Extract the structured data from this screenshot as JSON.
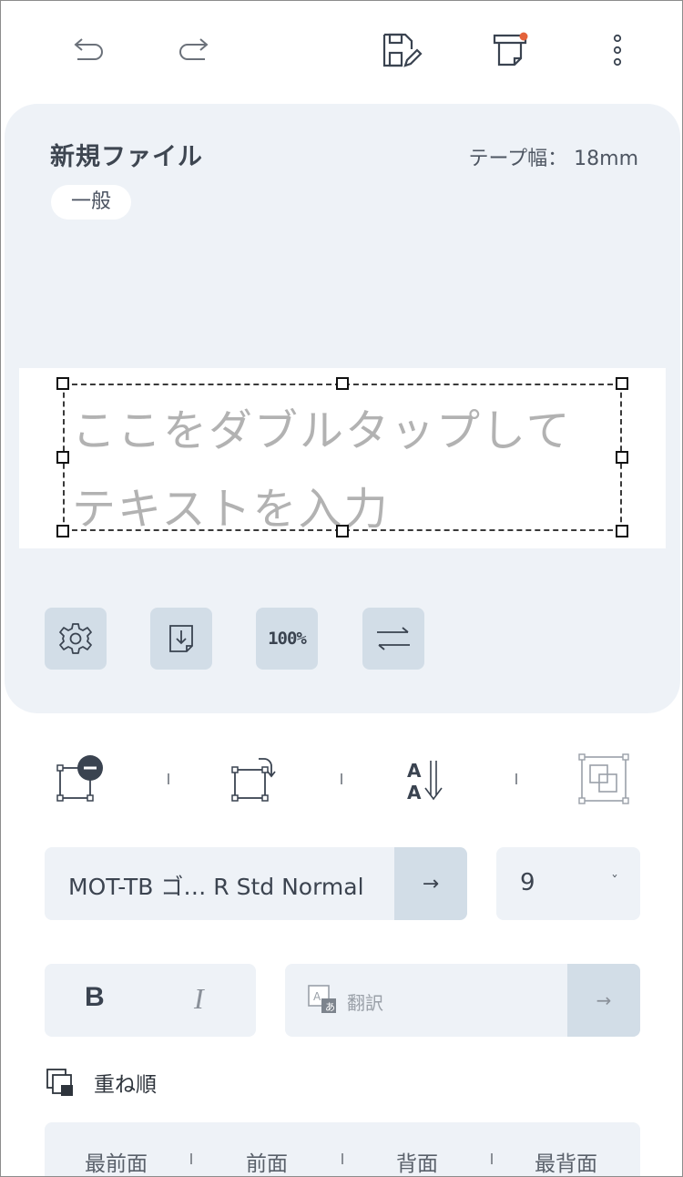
{
  "file": {
    "name": "新規ファイル",
    "tape_width_label": "テープ幅：",
    "tape_width_value": "18mm",
    "category": "一般"
  },
  "label": {
    "placeholder_line1": "ここをダブルタップして",
    "placeholder_line2": "テキストを入力"
  },
  "preview_toolbar": {
    "zoom": "100%"
  },
  "font": {
    "name": "MOT-TB ゴ… R Std Normal",
    "arrow": "→",
    "size": "9",
    "size_chevron": "ˇ"
  },
  "style": {
    "bold": "B",
    "italic": "I",
    "translate_label": "翻訳",
    "translate_arrow": "→"
  },
  "layer_order": {
    "title": "重ね順",
    "items": [
      "最前面",
      "前面",
      "背面",
      "最背面"
    ]
  },
  "colors": {
    "panel": "#eef2f7",
    "button": "#d2dde7",
    "accent_dot": "#e4623a",
    "text": "#3a4350"
  },
  "icons": [
    "undo-icon",
    "redo-icon",
    "save-edit-icon",
    "print-icon",
    "more-vertical-icon",
    "gear-icon",
    "import-icon",
    "swap-icon",
    "delete-object-icon",
    "rotate-icon",
    "vertical-text-icon",
    "group-icon",
    "layer-order-icon",
    "translate-icon"
  ]
}
